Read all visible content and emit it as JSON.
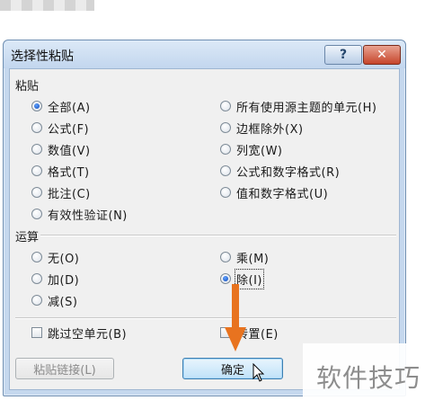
{
  "dialog": {
    "title": "选择性粘贴",
    "help_label": "?",
    "close_label": "✕"
  },
  "paste": {
    "label": "粘贴",
    "options": [
      {
        "label": "全部(A)",
        "selected": true
      },
      {
        "label": "公式(F)",
        "selected": false
      },
      {
        "label": "数值(V)",
        "selected": false
      },
      {
        "label": "格式(T)",
        "selected": false
      },
      {
        "label": "批注(C)",
        "selected": false
      },
      {
        "label": "有效性验证(N)",
        "selected": false
      },
      {
        "label": "所有使用源主题的单元(H)",
        "selected": false
      },
      {
        "label": "边框除外(X)",
        "selected": false
      },
      {
        "label": "列宽(W)",
        "selected": false
      },
      {
        "label": "公式和数字格式(R)",
        "selected": false
      },
      {
        "label": "值和数字格式(U)",
        "selected": false
      }
    ]
  },
  "operation": {
    "label": "运算",
    "options": [
      {
        "label": "无(O)",
        "selected": false
      },
      {
        "label": "加(D)",
        "selected": false
      },
      {
        "label": "减(S)",
        "selected": false
      },
      {
        "label": "乘(M)",
        "selected": false
      },
      {
        "label": "除(I)",
        "selected": true
      }
    ]
  },
  "checkboxes": {
    "skip_blanks": "跳过空单元(B)",
    "transpose": "转置(E)"
  },
  "buttons": {
    "paste_link": "粘贴链接(L)",
    "ok": "确定"
  },
  "watermark": "软件技巧",
  "colors": {
    "arrow": "#e8731f",
    "title_bar": "#c9dcf1",
    "close": "#c6452b"
  }
}
